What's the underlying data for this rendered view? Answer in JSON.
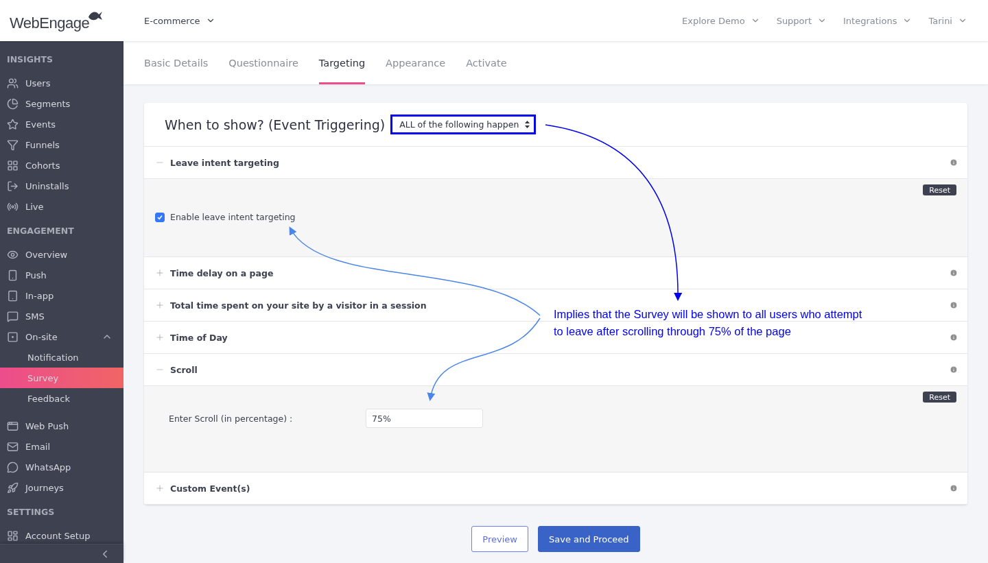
{
  "header": {
    "logo": "WebEngage",
    "project": "E-commerce",
    "nav": [
      "Explore Demo",
      "Support",
      "Integrations",
      "Tarini"
    ]
  },
  "sidebar": {
    "sections": [
      {
        "title": "INSIGHTS",
        "items": [
          {
            "label": "Users",
            "selected": false
          },
          {
            "label": "Segments",
            "selected": false
          },
          {
            "label": "Events",
            "selected": false
          },
          {
            "label": "Funnels",
            "selected": false
          },
          {
            "label": "Cohorts",
            "selected": false
          },
          {
            "label": "Uninstalls",
            "selected": false
          },
          {
            "label": "Live",
            "selected": false
          }
        ]
      },
      {
        "title": "ENGAGEMENT",
        "items": [
          {
            "label": "Overview",
            "selected": false
          },
          {
            "label": "Push",
            "selected": false
          },
          {
            "label": "In-app",
            "selected": false
          },
          {
            "label": "SMS",
            "selected": false
          },
          {
            "label": "On-site",
            "selected": false,
            "expanded": true,
            "children": [
              {
                "label": "Notification",
                "selected": false
              },
              {
                "label": "Survey",
                "selected": true
              },
              {
                "label": "Feedback",
                "selected": false
              }
            ]
          },
          {
            "label": "Web Push",
            "selected": false
          },
          {
            "label": "Email",
            "selected": false
          },
          {
            "label": "WhatsApp",
            "selected": false
          },
          {
            "label": "Journeys",
            "selected": false
          }
        ]
      },
      {
        "title": "SETTINGS",
        "items": [
          {
            "label": "Account Setup",
            "selected": false
          }
        ]
      }
    ]
  },
  "tabs": [
    {
      "label": "Basic Details",
      "selected": false
    },
    {
      "label": "Questionnaire",
      "selected": false
    },
    {
      "label": "Targeting",
      "selected": true
    },
    {
      "label": "Appearance",
      "selected": false
    },
    {
      "label": "Activate",
      "selected": false
    }
  ],
  "card": {
    "title": "When to show? (Event Triggering)",
    "select": "ALL of the following happen",
    "sections": [
      {
        "title": "Leave intent targeting",
        "expanded": true,
        "reset": "Reset",
        "body": {
          "kind": "checkbox",
          "label": "Enable leave intent targeting",
          "checked": true
        }
      },
      {
        "title": "Time delay on a page",
        "expanded": false
      },
      {
        "title": "Total time spent on your site by a visitor in a session",
        "expanded": false
      },
      {
        "title": "Time of Day",
        "expanded": false
      },
      {
        "title": "Scroll",
        "expanded": true,
        "reset": "Reset",
        "body": {
          "kind": "input",
          "label": "Enter Scroll (in percentage) :",
          "value": "75%"
        }
      },
      {
        "title": "Custom Event(s)",
        "expanded": false
      }
    ]
  },
  "buttons": [
    {
      "label": "Preview",
      "kind": "secondary"
    },
    {
      "label": "Save and Proceed",
      "kind": "primary"
    }
  ],
  "annotation": "Implies that the Survey will be shown to all users who attempt to leave after scrolling through 75% of the page"
}
